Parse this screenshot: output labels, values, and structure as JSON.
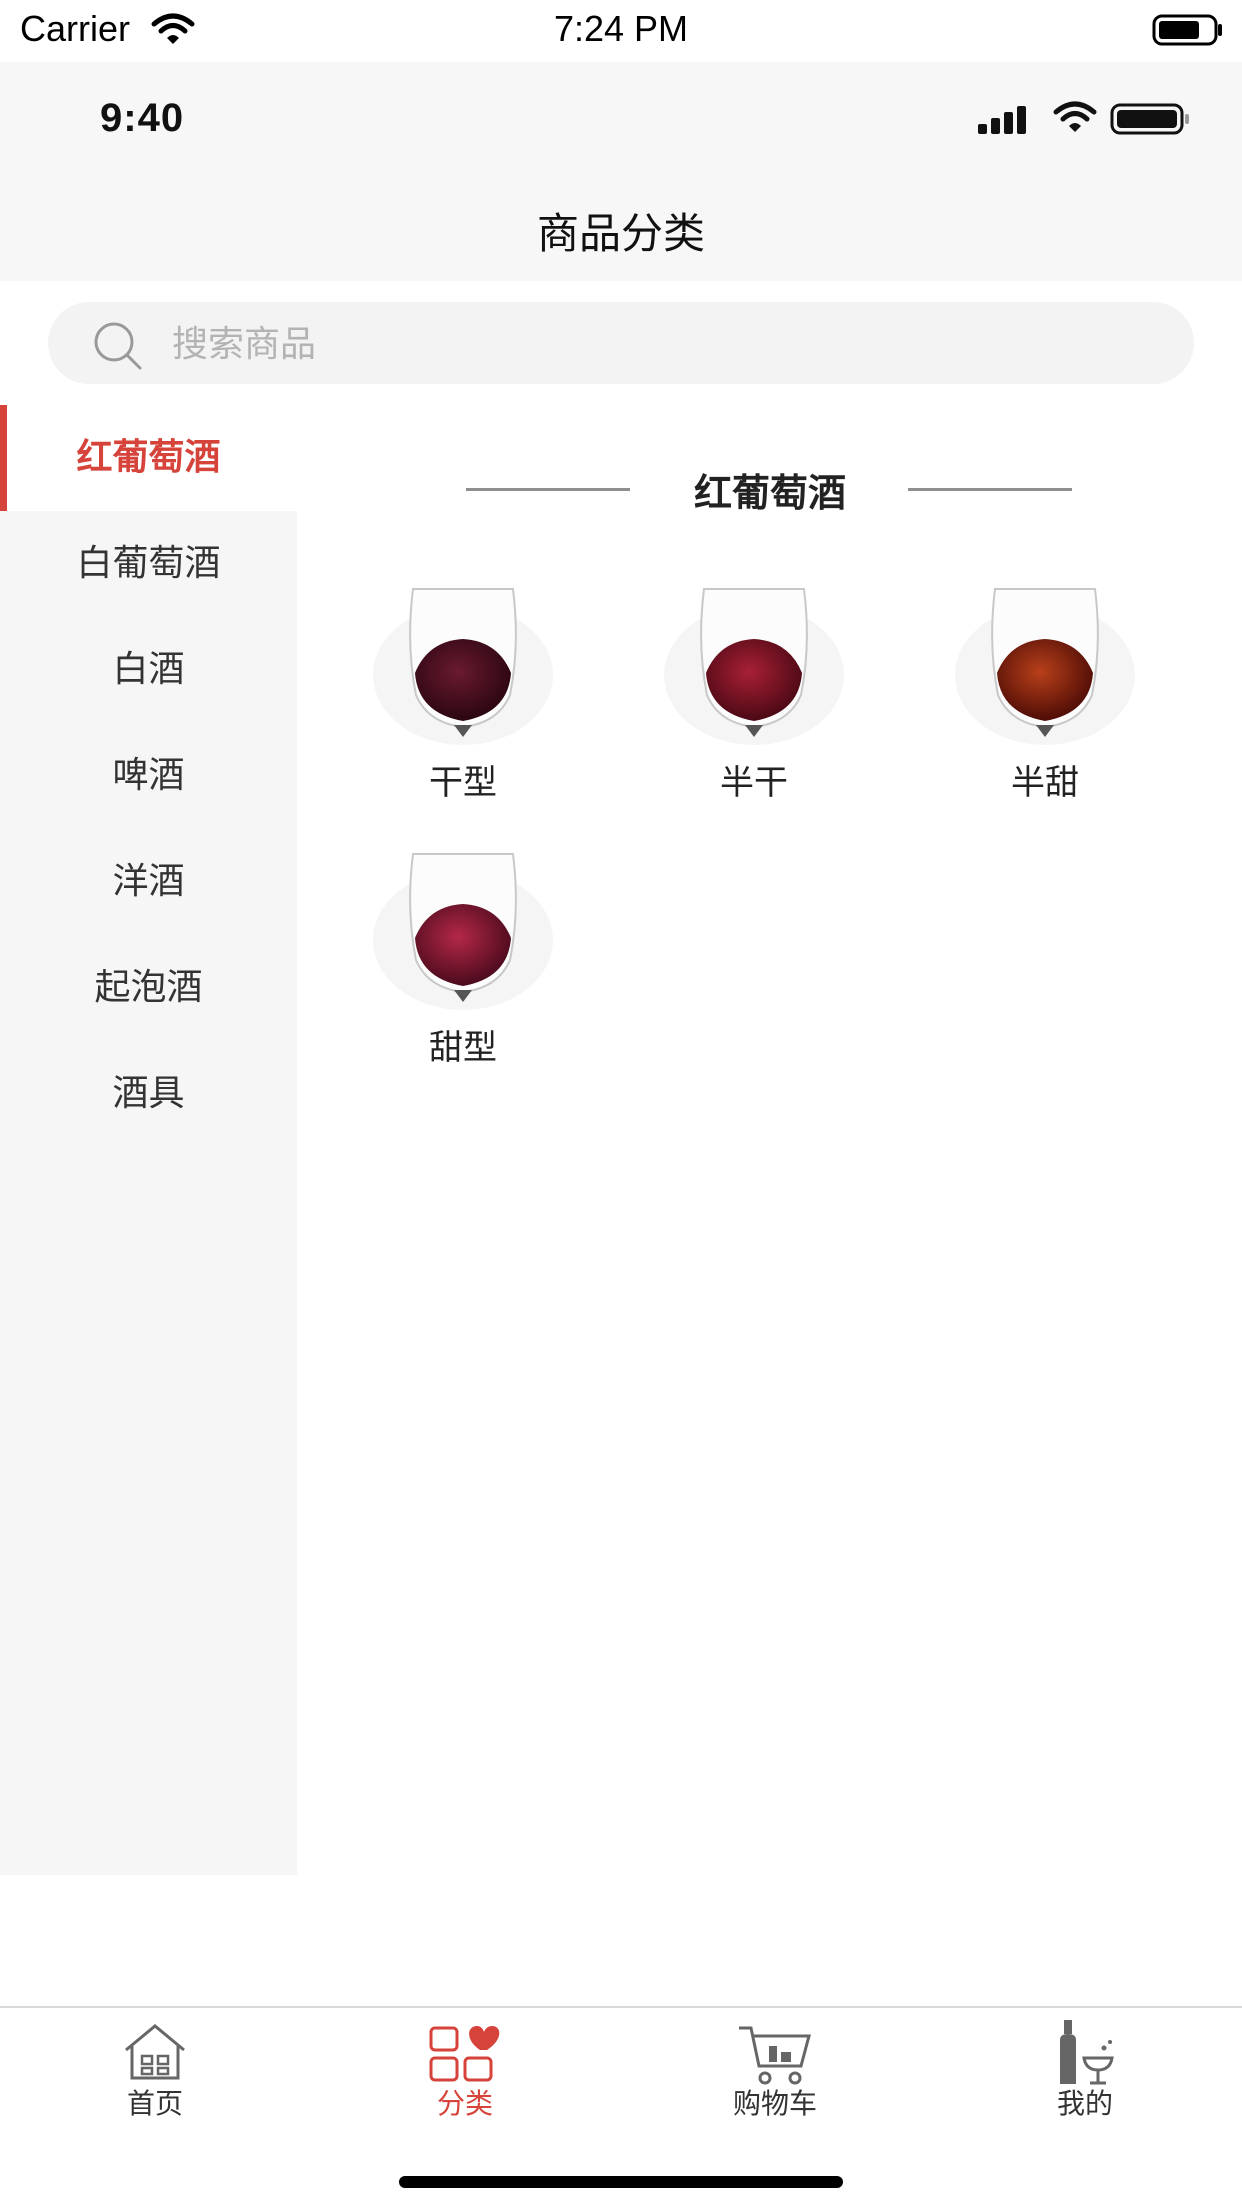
{
  "status_bar": {
    "carrier": "Carrier",
    "time": "7:24 PM"
  },
  "header": {
    "mock_time": "9:40",
    "title": "商品分类"
  },
  "search": {
    "placeholder": "搜索商品"
  },
  "sidebar": {
    "items": [
      {
        "label": "红葡萄酒",
        "active": true
      },
      {
        "label": "白葡萄酒"
      },
      {
        "label": "白酒"
      },
      {
        "label": "啤酒"
      },
      {
        "label": "洋酒"
      },
      {
        "label": "起泡酒"
      },
      {
        "label": "酒具"
      }
    ]
  },
  "main": {
    "section_title": "红葡萄酒",
    "items": [
      {
        "label": "干型",
        "wine_color": "#4a0c1c"
      },
      {
        "label": "半干",
        "wine_color": "#7a1124"
      },
      {
        "label": "半甜",
        "wine_color": "#8a2410"
      },
      {
        "label": "甜型",
        "wine_color": "#861630"
      }
    ]
  },
  "tabbar": {
    "items": [
      {
        "label": "首页",
        "icon": "home-icon"
      },
      {
        "label": "分类",
        "icon": "category-icon",
        "active": true
      },
      {
        "label": "购物车",
        "icon": "cart-icon"
      },
      {
        "label": "我的",
        "icon": "profile-bottle-icon"
      }
    ]
  },
  "colors": {
    "accent": "#d6433a",
    "sidebar_bg": "#f6f6f6",
    "header_bg": "#f7f7f7"
  }
}
